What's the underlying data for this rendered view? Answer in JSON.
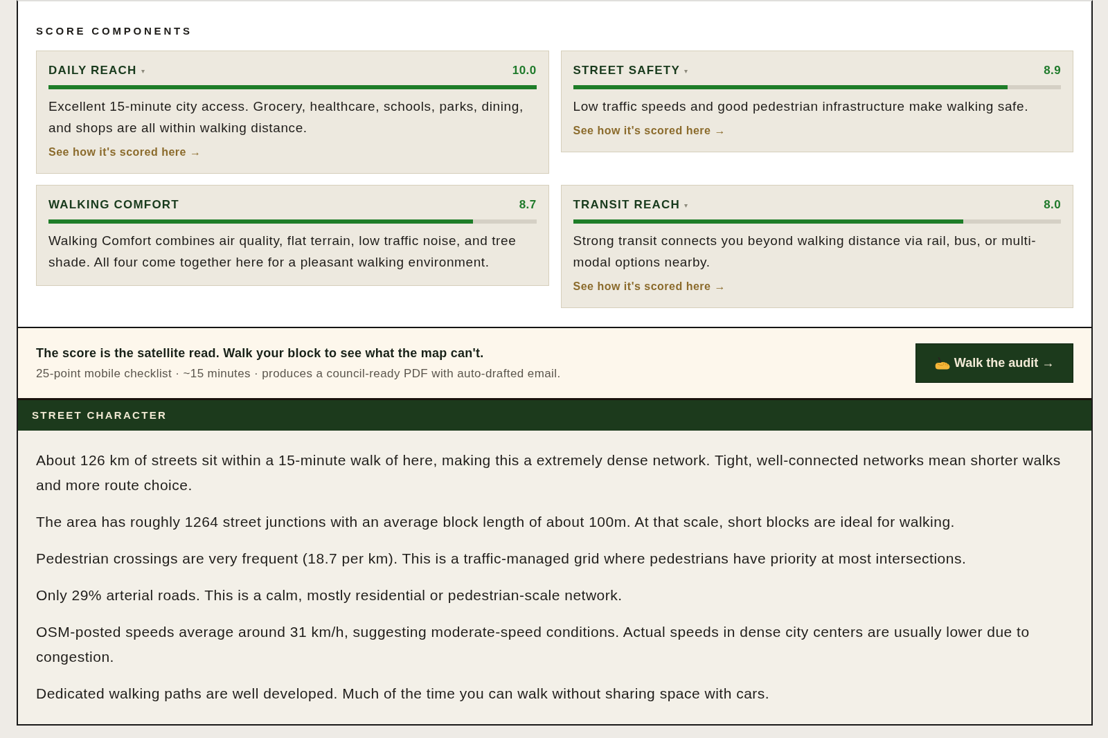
{
  "score_components": {
    "title": "SCORE COMPONENTS",
    "cards": [
      {
        "title": "DAILY REACH",
        "caret": "▾",
        "score": "10.0",
        "level": 1.0,
        "description": "Excellent 15-minute city access. Grocery, healthcare, schools, parks, dining, and shops are all within walking distance.",
        "link": "See how it's scored here →"
      },
      {
        "title": "STREET SAFETY",
        "caret": "▾",
        "score": "8.9",
        "level": 0.89,
        "description": "Low traffic speeds and good pedestrian infrastructure make walking safe.",
        "link": "See how it's scored here →"
      },
      {
        "title": "WALKING COMFORT",
        "score": "8.7",
        "level": 0.87,
        "description": "Walking Comfort combines air quality, flat terrain, low traffic noise, and tree shade. All four come together here for a pleasant walking environment."
      },
      {
        "title": "TRANSIT REACH",
        "caret": "▾",
        "score": "8.0",
        "level": 0.8,
        "description": "Strong transit connects you beyond walking distance via rail, bus, or multi-modal options nearby.",
        "link": "See how it's scored here →"
      }
    ]
  },
  "audit_callout": {
    "headline": "The score is the satellite read. Walk your block to see what the map can't.",
    "details": "25-point mobile checklist · ~15 minutes · produces a council-ready PDF with auto-drafted email.",
    "button": "Walk the audit →"
  },
  "street_character": {
    "title": "STREET CHARACTER",
    "paragraphs": [
      "About 126 km of streets sit within a 15-minute walk of here, making this a extremely dense network. Tight, well-connected networks mean shorter walks and more route choice.",
      "The area has roughly 1264 street junctions with an average block length of about 100m. At that scale, short blocks are ideal for walking.",
      "Pedestrian crossings are very frequent (18.7 per km). This is a traffic-managed grid where pedestrians have priority at most intersections.",
      "Only 29% arterial roads. This is a calm, mostly residential or pedestrian-scale network.",
      "OSM-posted speeds average around 31 km/h, suggesting moderate-speed conditions. Actual speeds in dense city centers are usually lower due to congestion.",
      "Dedicated walking paths are well developed. Much of the time you can walk without sharing space with cars."
    ]
  }
}
